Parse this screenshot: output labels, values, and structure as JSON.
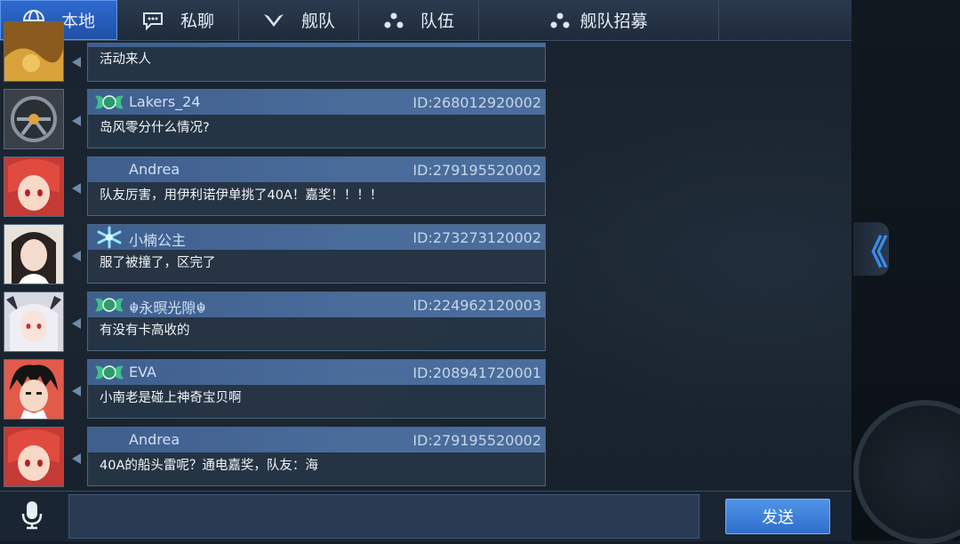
{
  "tabs": [
    {
      "label": "本地",
      "icon": "globe-icon",
      "active": true
    },
    {
      "label": "私聊",
      "icon": "speech-bubble-icon",
      "active": false
    },
    {
      "label": "舰队",
      "icon": "fleet-emblem-icon",
      "active": false
    },
    {
      "label": "队伍",
      "icon": "team-dots-icon",
      "active": false
    },
    {
      "label": "舰队招募",
      "icon": "recruit-dots-icon",
      "active": false
    }
  ],
  "messages": [
    {
      "name": "",
      "id": "",
      "text": "活动来人",
      "badge": "",
      "partial": true
    },
    {
      "name": "Lakers_24",
      "id": "ID:268012920002",
      "text": "岛风零分什么情况?",
      "badge": "wing-badge"
    },
    {
      "name": "Andrea",
      "id": "ID:279195520002",
      "text": "队友厉害，用伊利诺伊单挑了40A！嘉奖！！！！",
      "badge": ""
    },
    {
      "name": "小楠公主",
      "id": "ID:273273120002",
      "text": "服了被撞了，区完了",
      "badge": "snowflake-badge"
    },
    {
      "name": "☬永暝光隙☬",
      "id": "ID:224962120003",
      "text": "有没有卡高收的",
      "badge": "wing-badge"
    },
    {
      "name": "EVA",
      "id": "ID:208941720001",
      "text": "小南老是碰上神奇宝贝啊",
      "badge": "wing-badge"
    },
    {
      "name": "Andrea",
      "id": "ID:279195520002",
      "text": "40A的船头雷呢？通电嘉奖，队友：海",
      "badge": ""
    }
  ],
  "input": {
    "value": ""
  },
  "send_label": "发送",
  "collapse_label": "《",
  "colors": {
    "accent": "#2f6bd0",
    "bubble_header": "#4a6c9b",
    "send": "#3f86dd"
  }
}
